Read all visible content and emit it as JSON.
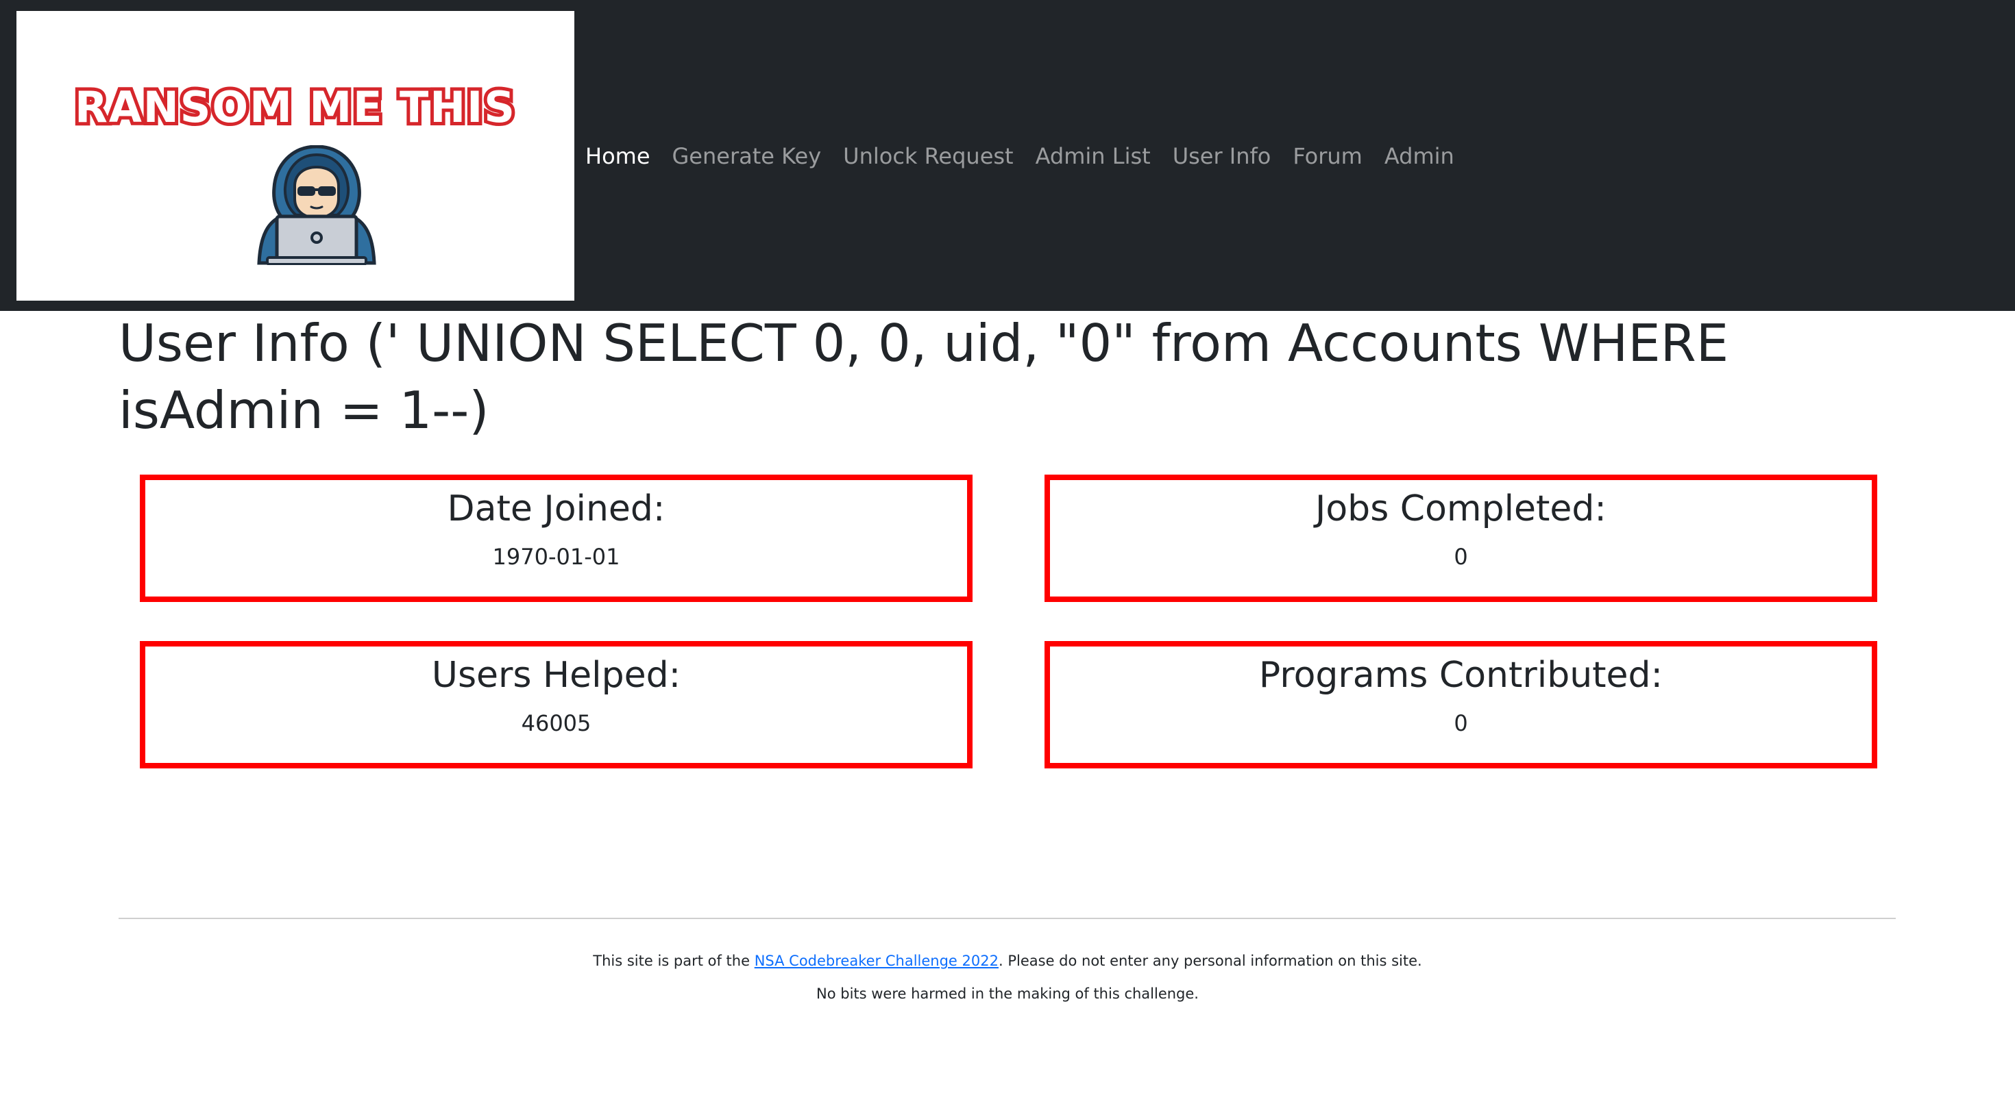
{
  "navbar": {
    "logo_text": "RANSOM ME THIS",
    "logo_icon": "hooded-hacker-laptop-icon",
    "links": [
      {
        "label": "Home",
        "active": true
      },
      {
        "label": "Generate Key",
        "active": false
      },
      {
        "label": "Unlock Request",
        "active": false
      },
      {
        "label": "Admin List",
        "active": false
      },
      {
        "label": "User Info",
        "active": false
      },
      {
        "label": "Forum",
        "active": false
      },
      {
        "label": "Admin",
        "active": false
      }
    ]
  },
  "main": {
    "title": "User Info (' UNION SELECT 0, 0, uid, \"0\" from Accounts WHERE isAdmin = 1--)",
    "stats": {
      "date_joined": {
        "label": "Date Joined:",
        "value": "1970-01-01"
      },
      "jobs_completed": {
        "label": "Jobs Completed:",
        "value": "0"
      },
      "users_helped": {
        "label": "Users Helped:",
        "value": "46005"
      },
      "programs_contributed": {
        "label": "Programs Contributed:",
        "value": "0"
      }
    }
  },
  "footer": {
    "line1_before": "This site is part of the ",
    "line1_link": "NSA Codebreaker Challenge 2022",
    "line1_after": ". Please do not enter any personal information on this site.",
    "line2": "No bits were harmed in the making of this challenge."
  },
  "colors": {
    "navbar_bg": "#212529",
    "card_border": "#ff0000",
    "link": "#0d6efd",
    "logo_red": "#d6262b"
  }
}
